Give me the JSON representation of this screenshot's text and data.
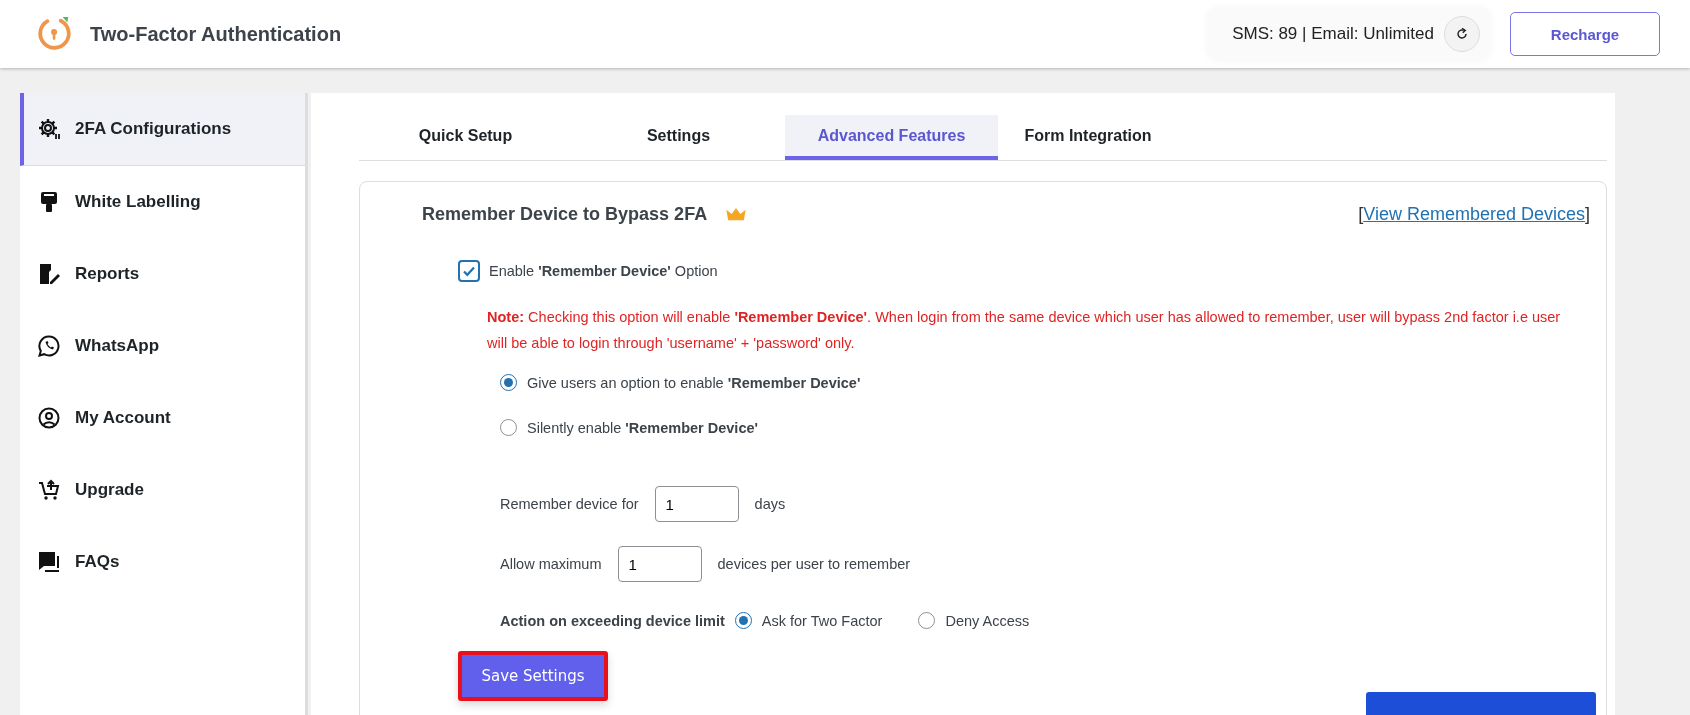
{
  "header": {
    "title": "Two-Factor Authentication",
    "balance": "SMS: 89 | Email: Unlimited",
    "recharge": "Recharge"
  },
  "sidebar": {
    "items": [
      {
        "label": "2FA Configurations",
        "selected": true
      },
      {
        "label": "White Labelling",
        "selected": false
      },
      {
        "label": "Reports",
        "selected": false
      },
      {
        "label": "WhatsApp",
        "selected": false
      },
      {
        "label": "My Account",
        "selected": false
      },
      {
        "label": "Upgrade",
        "selected": false
      },
      {
        "label": "FAQs",
        "selected": false
      }
    ]
  },
  "tabs": [
    {
      "label": "Quick Setup",
      "selected": false
    },
    {
      "label": "Settings",
      "selected": false
    },
    {
      "label": "Advanced Features",
      "selected": true
    },
    {
      "label": "Form Integration",
      "selected": false
    }
  ],
  "section": {
    "title": "Remember Device to Bypass 2FA",
    "premium": true,
    "link_open": "[",
    "link": "View Remembered Devices",
    "link_close": "]",
    "enable": {
      "label": "Enable **'Remember Device'** Option",
      "checked": true
    },
    "note": "**Note:** Checking this option will enable **'Remember Device'**. When login from the same device which user has allowed to remember, user will bypass 2nd factor i.e user will be able to login through 'username' + 'password' only.",
    "modes": [
      {
        "label": "Give users an option to enable **'Remember Device'**",
        "selected": true
      },
      {
        "label": "Silently enable **'Remember Device'**",
        "selected": false
      }
    ],
    "days": {
      "before": "Remember device for",
      "value": "1",
      "after": "days"
    },
    "devices": {
      "before": "Allow maximum",
      "value": "1",
      "after": "devices per user to remember"
    },
    "action": {
      "label": "Action on exceeding device limit",
      "options": [
        {
          "label": "Ask for Two Factor",
          "selected": true
        },
        {
          "label": "Deny Access",
          "selected": false
        }
      ]
    },
    "save": "Save Settings"
  }
}
